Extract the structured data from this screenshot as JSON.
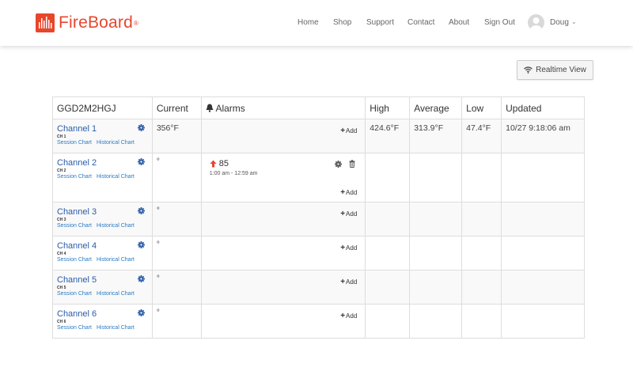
{
  "brand": {
    "name": "FireBoard",
    "reg": "®"
  },
  "nav": {
    "links": [
      "Home",
      "Shop",
      "Support",
      "Contact",
      "About",
      "Sign Out"
    ],
    "user": "Doug"
  },
  "realtime_button": "Realtime View",
  "table": {
    "headers": {
      "device": "GGD2M2HGJ",
      "current": "Current",
      "alarms": "Alarms",
      "high": "High",
      "average": "Average",
      "low": "Low",
      "updated": "Updated"
    },
    "session_chart": "Session Chart",
    "historical_chart": "Historical Chart",
    "add_label": "Add",
    "rows": [
      {
        "name": "Channel 1",
        "sub": "CH 1",
        "current": "356°F",
        "high": "424.6°F",
        "average": "313.9°F",
        "low": "47.4°F",
        "updated": "10/27 9:18:06 am"
      },
      {
        "name": "Channel 2",
        "sub": "CH 2",
        "current": "°",
        "alarm": {
          "value": "85",
          "time": "1:00 am - 12:59 am"
        }
      },
      {
        "name": "Channel 3",
        "sub": "CH 3",
        "current": "°"
      },
      {
        "name": "Channel 4",
        "sub": "CH 4",
        "current": "°"
      },
      {
        "name": "Channel 5",
        "sub": "CH 5",
        "current": "°"
      },
      {
        "name": "Channel 6",
        "sub": "CH 6",
        "current": "°"
      }
    ]
  },
  "colors": {
    "brand": "#e8462a",
    "link": "#2a5ca8",
    "alarm_arrow": "#e8462a"
  }
}
